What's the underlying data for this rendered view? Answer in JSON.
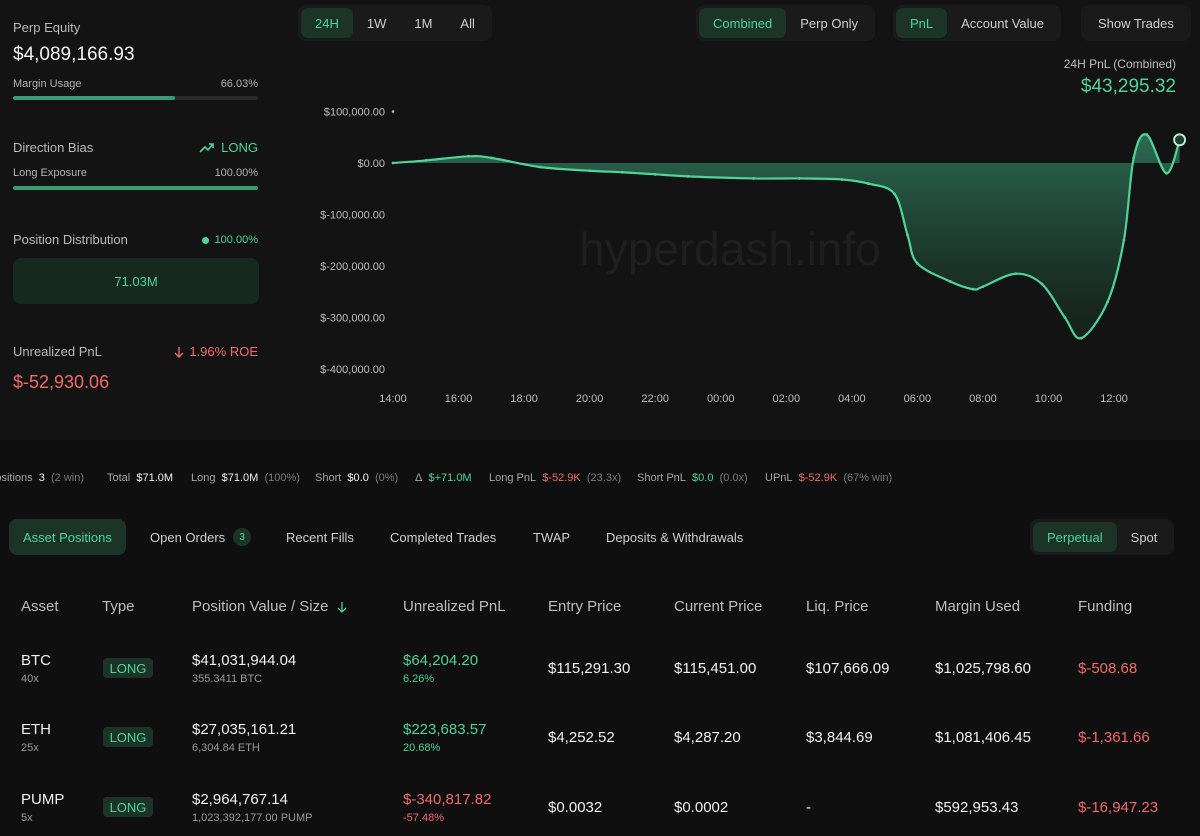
{
  "account": {
    "perp_equity_label": "Perp Equity",
    "perp_equity_value": "$4,089,166.93",
    "margin_usage_label": "Margin Usage",
    "margin_usage_value": "66.03%",
    "margin_usage_fraction": 0.6603,
    "direction_bias_label": "Direction Bias",
    "direction_bias_value": "LONG",
    "long_exposure_label": "Long Exposure",
    "long_exposure_value": "100.00%",
    "long_exposure_fraction": 1.0,
    "position_distribution_label": "Position Distribution",
    "position_distribution_value": "100.00%",
    "position_distribution_amount": "71.03M",
    "unrealized_pnl_label": "Unrealized PnL",
    "roe_value": "1.96% ROE",
    "unrealized_pnl_value": "$-52,930.06"
  },
  "time_filters": [
    "24H",
    "1W",
    "1M",
    "All"
  ],
  "active_time_filter": "24H",
  "view_mode": [
    "Combined",
    "Perp Only"
  ],
  "active_view_mode": "Combined",
  "metric_mode": [
    "PnL",
    "Account Value"
  ],
  "active_metric_mode": "PnL",
  "show_trades_label": "Show Trades",
  "pnl_header": {
    "label": "24H PnL (Combined)",
    "value": "$43,295.32"
  },
  "watermark": "hyperdash.info",
  "chart_data": {
    "type": "area",
    "x_ticks": [
      "14:00",
      "16:00",
      "18:00",
      "20:00",
      "22:00",
      "00:00",
      "02:00",
      "04:00",
      "06:00",
      "08:00",
      "10:00",
      "12:00"
    ],
    "y_ticks": [
      "$100,000.00",
      "$0.00",
      "$-100,000.00",
      "$-200,000.00",
      "$-300,000.00",
      "$-400,000.00"
    ],
    "ylim": [
      -400000,
      100000
    ],
    "x_hours": [
      0,
      1,
      2.3,
      3,
      4.5,
      6,
      7,
      8,
      9,
      11,
      12.4,
      13.7,
      14.5,
      15.3,
      15.7,
      16.0,
      17,
      17.7,
      18,
      19,
      19.8,
      20.5,
      21,
      21.8,
      22.3,
      22.6,
      23,
      23.6,
      24
    ],
    "y_values": [
      0,
      5000,
      13000,
      10000,
      -8000,
      -15000,
      -18000,
      -22000,
      -26000,
      -30000,
      -30000,
      -32000,
      -40000,
      -60000,
      -140000,
      -195000,
      -230000,
      -245000,
      -240000,
      -215000,
      -235000,
      -300000,
      -340000,
      -270000,
      -150000,
      10000,
      55000,
      -20000,
      45000
    ]
  },
  "stats": {
    "positions_label": "Positions",
    "positions_value": "3",
    "positions_win": "(2 win)",
    "total_label": "Total",
    "total_value": "$71.0M",
    "long_label": "Long",
    "long_value": "$71.0M",
    "long_pct": "(100%)",
    "short_label": "Short",
    "short_value": "$0.0",
    "short_pct": "(0%)",
    "delta_label": "Δ",
    "delta_value": "$+71.0M",
    "long_pnl_label": "Long PnL",
    "long_pnl_value": "$-52.9K",
    "long_pnl_x": "(23.3x)",
    "short_pnl_label": "Short PnL",
    "short_pnl_value": "$0.0",
    "short_pnl_x": "(0.0x)",
    "upnl_label": "UPnL",
    "upnl_value": "$-52.9K",
    "upnl_win": "(67% win)"
  },
  "tabs": {
    "asset_positions": "Asset Positions",
    "open_orders": "Open Orders",
    "open_orders_count": "3",
    "recent_fills": "Recent Fills",
    "completed_trades": "Completed Trades",
    "twap": "TWAP",
    "deposits_withdrawals": "Deposits & Withdrawals",
    "perpetual": "Perpetual",
    "spot": "Spot"
  },
  "table": {
    "headers": {
      "asset": "Asset",
      "type": "Type",
      "position_value": "Position Value / Size",
      "unrealized_pnl": "Unrealized PnL",
      "entry_price": "Entry Price",
      "current_price": "Current Price",
      "liq_price": "Liq. Price",
      "margin_used": "Margin Used",
      "funding": "Funding"
    },
    "rows": [
      {
        "asset": "BTC",
        "leverage": "40x",
        "type": "LONG",
        "value": "$41,031,944.04",
        "size": "355.3411 BTC",
        "pnl": "$64,204.20",
        "pnl_pct": "6.26%",
        "entry": "$115,291.30",
        "current": "$115,451.00",
        "liq": "$107,666.09",
        "margin": "$1,025,798.60",
        "funding": "$-508.68"
      },
      {
        "asset": "ETH",
        "leverage": "25x",
        "type": "LONG",
        "value": "$27,035,161.21",
        "size": "6,304.84 ETH",
        "pnl": "$223,683.57",
        "pnl_pct": "20.68%",
        "entry": "$4,252.52",
        "current": "$4,287.20",
        "liq": "$3,844.69",
        "margin": "$1,081,406.45",
        "funding": "$-1,361.66"
      },
      {
        "asset": "PUMP",
        "leverage": "5x",
        "type": "LONG",
        "value": "$2,964,767.14",
        "size": "1,023,392,177.00 PUMP",
        "pnl": "$-340,817.82",
        "pnl_pct": "-57.48%",
        "entry": "$0.0032",
        "current": "$0.0002",
        "liq": "-",
        "margin": "$592,953.43",
        "funding": "$-16,947.23"
      }
    ]
  },
  "colors": {
    "accent_green": "#4fd39b",
    "loss_red": "#ef6b6b",
    "background": "#0f0f0f"
  }
}
